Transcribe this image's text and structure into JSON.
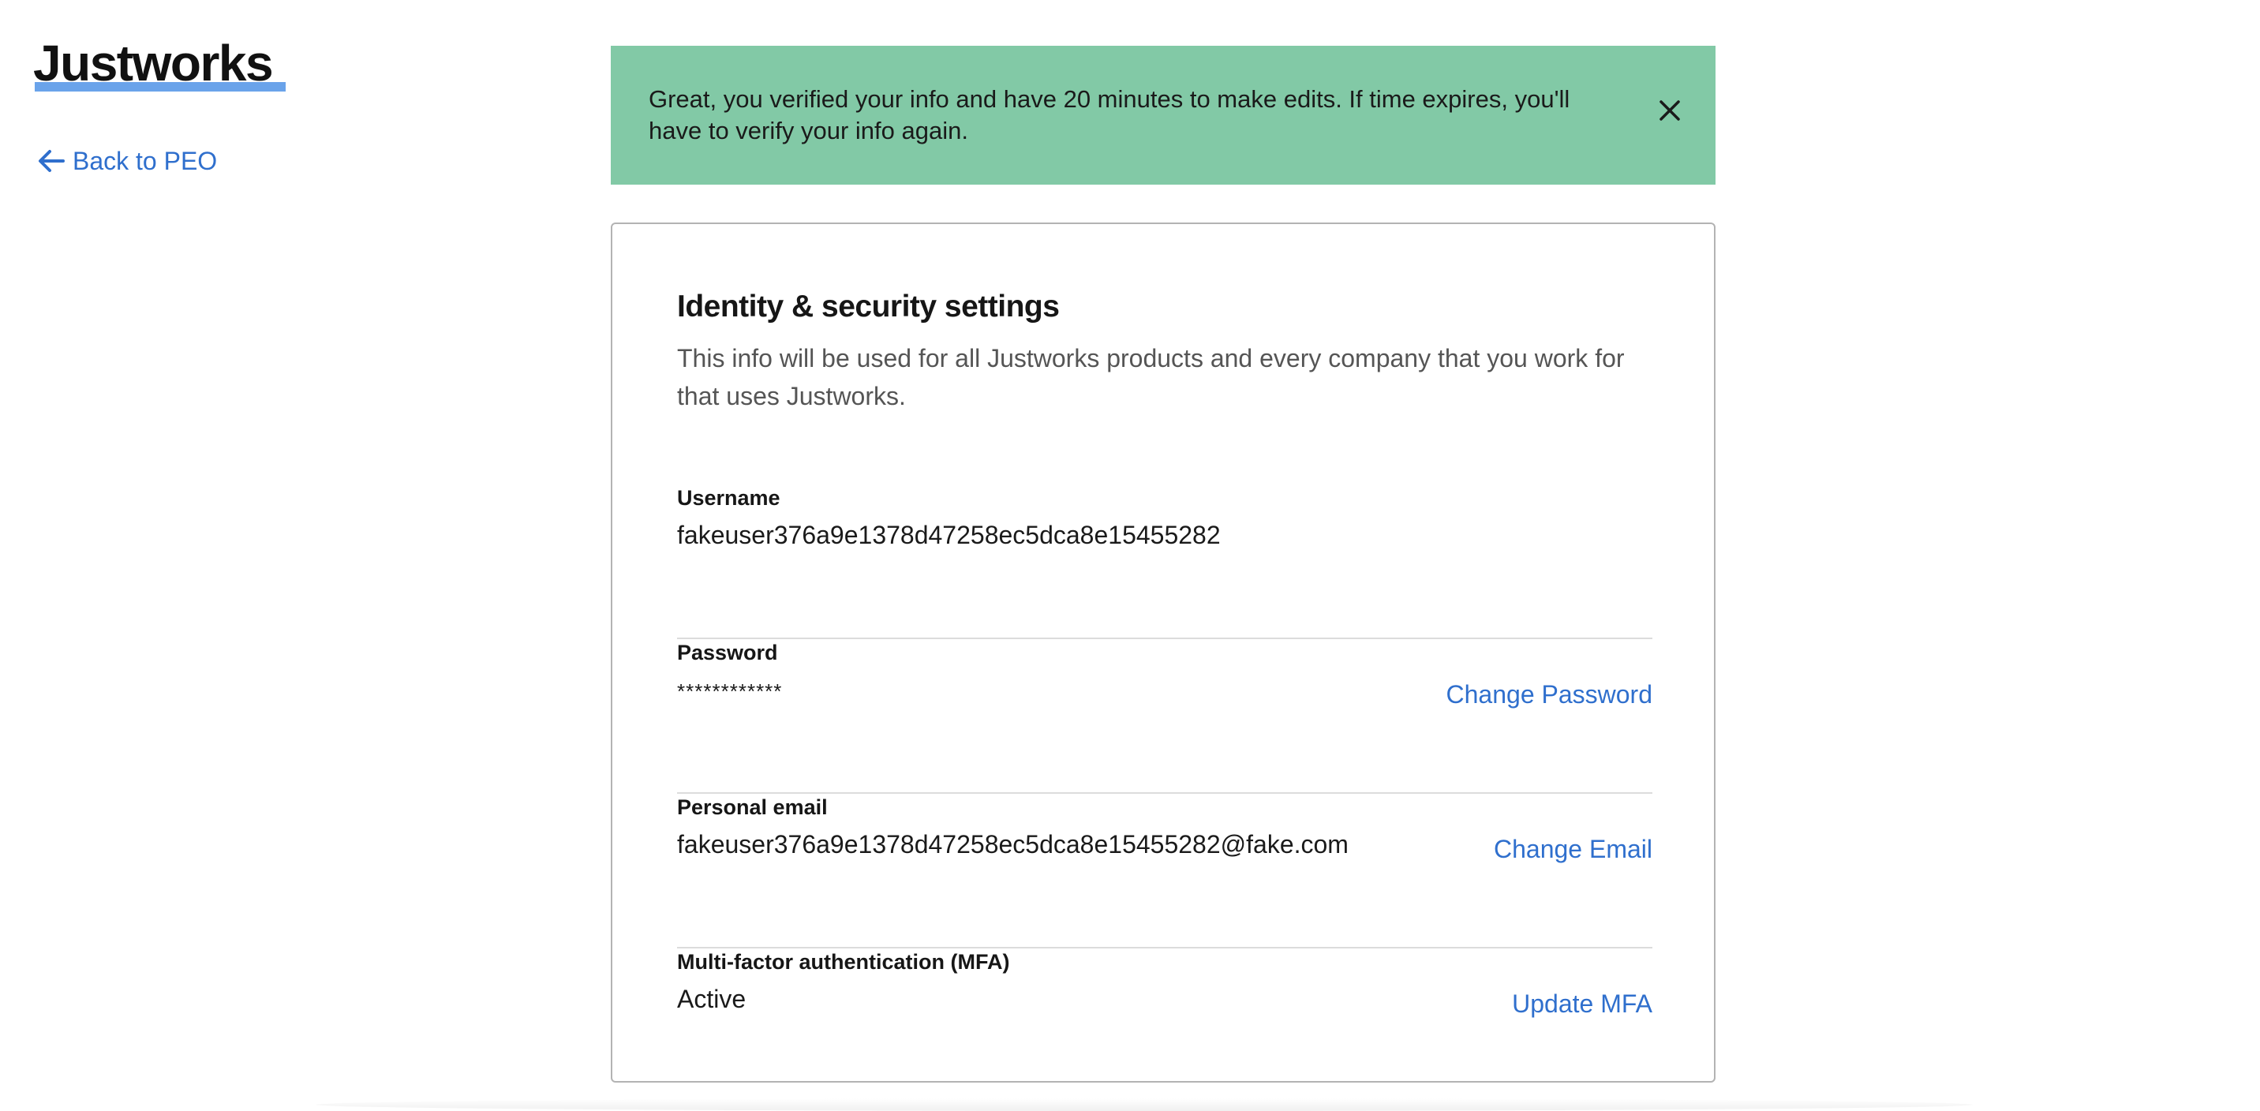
{
  "brand": {
    "logo_text": "Justworks"
  },
  "nav": {
    "back_label": "Back to PEO"
  },
  "banner": {
    "message": "Great, you verified your info and have 20 minutes to make edits. If time expires, you'll have to verify your info again.",
    "close_icon": "close-icon",
    "background_color": "#82c9a6"
  },
  "card": {
    "title": "Identity & security settings",
    "description": "This info will be used for all Justworks products and every company that you work for that uses Justworks.",
    "rows": [
      {
        "label": "Username",
        "value": "fakeuser376a9e1378d47258ec5dca8e15455282",
        "action": ""
      },
      {
        "label": "Password",
        "value": "************",
        "action": "Change Password"
      },
      {
        "label": "Personal email",
        "value": "fakeuser376a9e1378d47258ec5dca8e15455282@fake.com",
        "action": "Change Email"
      },
      {
        "label": "Multi-factor authentication (MFA)",
        "value": "Active",
        "action": "Update MFA"
      }
    ]
  },
  "colors": {
    "link": "#2f6fcd",
    "logo_underline": "#6aa3ea",
    "border": "#b3b3b3"
  }
}
